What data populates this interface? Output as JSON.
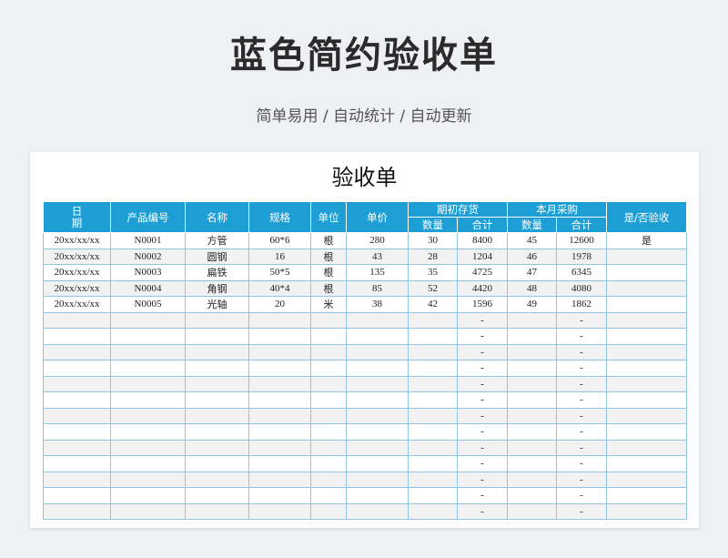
{
  "page": {
    "title": "蓝色简约验收单",
    "subtitle": "简单易用 / 自动统计 / 自动更新"
  },
  "sheet": {
    "title": "验收单",
    "headers": {
      "date_line1": "日",
      "date_line2": "期",
      "code": "产品编号",
      "name": "名称",
      "spec": "规格",
      "unit": "单位",
      "price": "单价",
      "opening_stock": "期初存货",
      "monthly_purchase": "本月采购",
      "qty": "数量",
      "total": "合计",
      "accepted": "是/否验收"
    },
    "rows": [
      {
        "date": "20xx/xx/xx",
        "code": "N0001",
        "name": "方管",
        "spec": "60*6",
        "unit": "根",
        "price": "280",
        "open_qty": "30",
        "open_total": "8400",
        "buy_qty": "45",
        "buy_total": "12600",
        "accepted": "是"
      },
      {
        "date": "20xx/xx/xx",
        "code": "N0002",
        "name": "圆钢",
        "spec": "16",
        "unit": "根",
        "price": "43",
        "open_qty": "28",
        "open_total": "1204",
        "buy_qty": "46",
        "buy_total": "1978",
        "accepted": ""
      },
      {
        "date": "20xx/xx/xx",
        "code": "N0003",
        "name": "扁铁",
        "spec": "50*5",
        "unit": "根",
        "price": "135",
        "open_qty": "35",
        "open_total": "4725",
        "buy_qty": "47",
        "buy_total": "6345",
        "accepted": ""
      },
      {
        "date": "20xx/xx/xx",
        "code": "N0004",
        "name": "角钢",
        "spec": "40*4",
        "unit": "根",
        "price": "85",
        "open_qty": "52",
        "open_total": "4420",
        "buy_qty": "48",
        "buy_total": "4080",
        "accepted": ""
      },
      {
        "date": "20xx/xx/xx",
        "code": "N0005",
        "name": "光轴",
        "spec": "20",
        "unit": "米",
        "price": "38",
        "open_qty": "42",
        "open_total": "1596",
        "buy_qty": "49",
        "buy_total": "1862",
        "accepted": ""
      }
    ],
    "empty_dash": "-"
  }
}
